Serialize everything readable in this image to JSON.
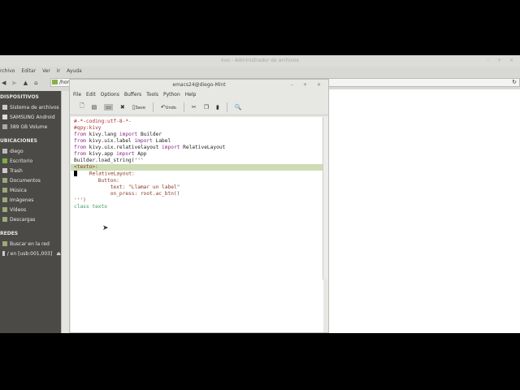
{
  "file_manager": {
    "title": "kvo - Administrador de archivos",
    "window_controls": "– + ×",
    "menu": [
      "rchivo",
      "Editar",
      "Ver",
      "Ir",
      "Ayuda"
    ],
    "path": "/hom",
    "sidebar": {
      "devices_header": "DISPOSITIVOS",
      "devices": [
        "Sistema de archivos",
        "SAMSUNG Android",
        "389 GB Volume"
      ],
      "places_header": "UBICACIONES",
      "places": [
        "diego",
        "Escritorio",
        "Trash",
        "Documentos",
        "Música",
        "Imágenes",
        "Vídeos",
        "Descargas"
      ],
      "network_header": "REDES",
      "network": [
        "Buscar en la red",
        "/ en [usb:001,003]"
      ]
    }
  },
  "emacs": {
    "title": "emacs24@diego-Mint",
    "window_controls": "– + ×",
    "menu": [
      "File",
      "Edit",
      "Options",
      "Buffers",
      "Tools",
      "Python",
      "Help"
    ],
    "toolbar": {
      "save": "Save",
      "undo": "Undo"
    },
    "code": [
      "#-*-coding:utf-8-*-",
      "#qpy:kivy",
      "from kivy.lang import Builder",
      "from kivy.uix.label import Label",
      "from kivy.uix.relativelayout import RelativeLayout",
      "from kivy.app import App",
      "",
      "Builder.load_string('''",
      "<texto>:",
      "    RelativeLayout:",
      "        Button:",
      "            text: \"Llamar un label\"",
      "            on_press: root.ac_btn()",
      "''')",
      "",
      "class texto"
    ]
  }
}
